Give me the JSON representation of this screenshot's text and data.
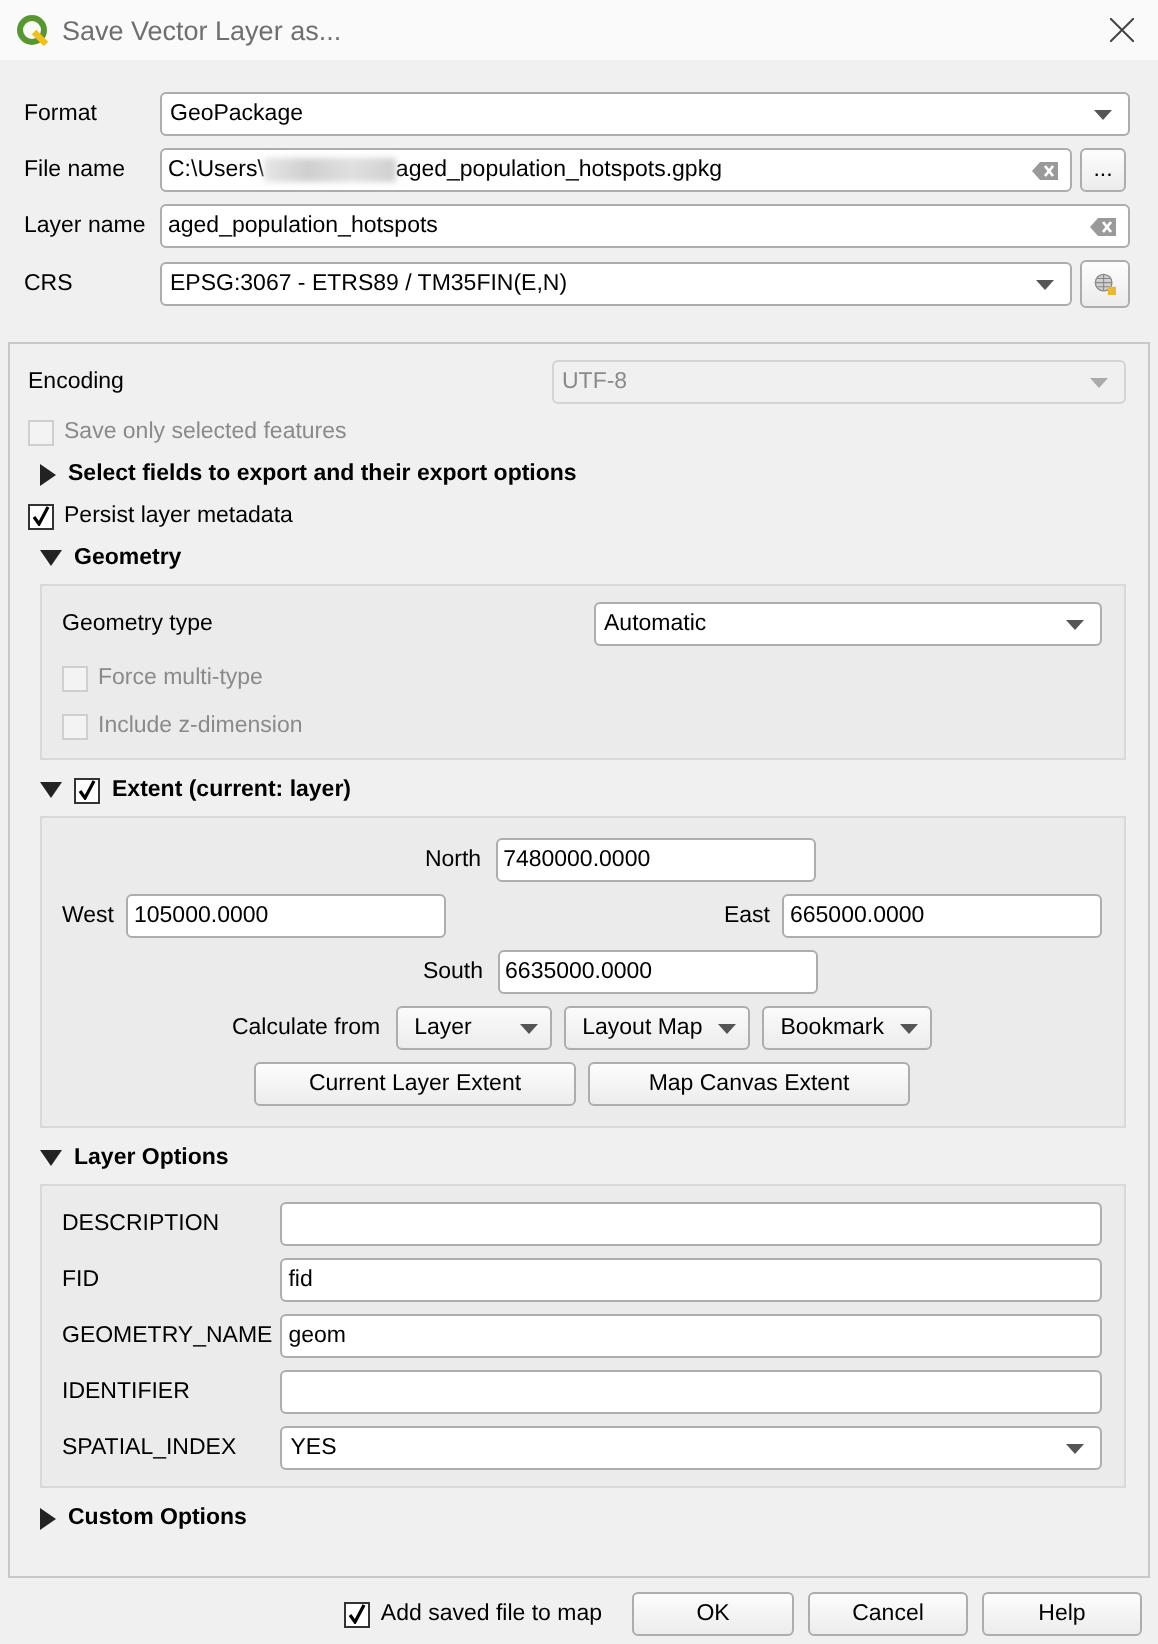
{
  "window": {
    "title": "Save Vector Layer as..."
  },
  "format": {
    "label": "Format",
    "value": "GeoPackage"
  },
  "file_name": {
    "label": "File name",
    "value_start": "C:\\Users\\",
    "value_end": "aged_population_hotspots.gpkg",
    "browse": "..."
  },
  "layer_name": {
    "label": "Layer name",
    "value": "aged_population_hotspots"
  },
  "crs": {
    "label": "CRS",
    "value": "EPSG:3067 - ETRS89 / TM35FIN(E,N)"
  },
  "encoding": {
    "label": "Encoding",
    "value": "UTF-8",
    "disabled": true
  },
  "save_only_selected": {
    "label": "Save only selected features",
    "checked": false,
    "disabled": true
  },
  "select_fields": {
    "title": "Select fields to export and their export options",
    "expanded": false
  },
  "persist_metadata": {
    "label": "Persist layer metadata",
    "checked": true,
    "disabled": false
  },
  "geometry": {
    "title": "Geometry",
    "expanded": true,
    "type_label": "Geometry type",
    "type_value": "Automatic",
    "options": [
      {
        "label": "Force multi-type",
        "checked": false,
        "disabled": true
      },
      {
        "label": "Include z-dimension",
        "checked": false,
        "disabled": true
      }
    ]
  },
  "extent": {
    "title": "Extent (current: layer)",
    "expanded": true,
    "checked": true,
    "north": {
      "label": "North",
      "value": "7480000.0000"
    },
    "west": {
      "label": "West",
      "value": "105000.0000"
    },
    "east": {
      "label": "East",
      "value": "665000.0000"
    },
    "south": {
      "label": "South",
      "value": "6635000.0000"
    },
    "calculate_label": "Calculate from",
    "calculate_buttons": [
      "Layer",
      "Layout Map",
      "Bookmark"
    ],
    "buttons": [
      "Current Layer Extent",
      "Map Canvas Extent"
    ]
  },
  "layer_options": {
    "title": "Layer Options",
    "expanded": true,
    "rows": [
      {
        "label": "DESCRIPTION",
        "kind": "text"
      },
      {
        "label": "FID",
        "kind": "text",
        "value": "fid"
      },
      {
        "label": "GEOMETRY_NAME",
        "kind": "text",
        "value": "geom"
      },
      {
        "label": "IDENTIFIER",
        "kind": "text"
      },
      {
        "label": "SPATIAL_INDEX",
        "kind": "combo",
        "value": "YES"
      }
    ]
  },
  "custom_options": {
    "title": "Custom Options",
    "expanded": false
  },
  "add_to_map": {
    "label": "Add saved file to map",
    "checked": true,
    "disabled": false
  },
  "buttons": [
    "OK",
    "Cancel",
    "Help"
  ]
}
